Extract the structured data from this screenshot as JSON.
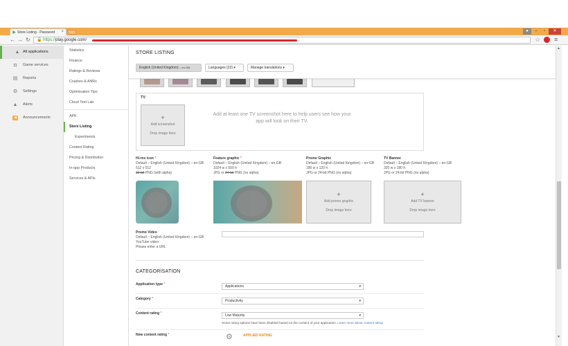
{
  "browser": {
    "tab_title": "Store Listing - Password",
    "tab_close": "×",
    "url_scheme": "https://",
    "url_domain": "play.google.com",
    "url_rest": "/",
    "window_controls": {
      "minimize": "–",
      "maximize": "▫",
      "close": "✕"
    }
  },
  "leftnav": {
    "items": [
      {
        "label": "All applications",
        "icon": "android-icon"
      },
      {
        "label": "Game services",
        "icon": "gamepad-icon"
      },
      {
        "label": "Reports",
        "icon": "report-icon"
      },
      {
        "label": "Settings",
        "icon": "gear-icon"
      },
      {
        "label": "Alerts",
        "icon": "warning-icon"
      },
      {
        "label": "Announcements",
        "icon": "announcement-icon"
      }
    ]
  },
  "subnav": {
    "items": [
      "Statistics",
      "Finance",
      "Ratings & Reviews",
      "Crashes & ANRs",
      "Optimisation Tips",
      "Cloud Test Lab",
      "APK",
      "Store Listing",
      "Experiments",
      "Content Rating",
      "Pricing & Distribution",
      "In-app Products",
      "Services & APIs"
    ]
  },
  "header": {
    "title": "STORE LISTING",
    "lang_button": "English (United Kingdom)",
    "lang_code": "– en-GB",
    "languages_button": "Languages (22)",
    "manage_button": "Manage translations",
    "caret": "▾"
  },
  "tv": {
    "label": "TV",
    "add_label": "Add screenshot",
    "drop_label": "Drop image here",
    "hint": "Add at least one TV screenshot here to help users see how your app will look on their TV."
  },
  "assets": {
    "hires": {
      "name": "Hi-res icon",
      "default": "Default – English (United Kingdom) – en-GB",
      "size": "512 x 512",
      "format_a": "32-bit",
      "format_b": " PNG (with alpha)"
    },
    "feature": {
      "name": "Feature graphic",
      "default": "Default – English (United Kingdom) – en-GB",
      "size": "1024 w x 500 h",
      "format_a": "JPG or ",
      "format_strike": "24-bit",
      "format_b": " PNG (no alpha)"
    },
    "promo": {
      "name": "Promo Graphic",
      "default": "Default – English (United Kingdom) – en-GB",
      "size": "180 w x 120 h",
      "format": "JPG or 24-bit PNG (no alpha)",
      "add_label": "Add promo graphic",
      "drop_label": "Drop image here"
    },
    "tvbanner": {
      "name": "TV Banner",
      "default": "Default – English (United Kingdom) – en-GB",
      "size": "320 w x 180 h",
      "format": "JPG or 24-bit PNG (no alpha)",
      "add_label": "Add TV banner",
      "drop_label": "Drop image here"
    },
    "required_mark": "*"
  },
  "promo_video": {
    "name": "Promo Video",
    "default": "Default – English (United Kingdom) – en-GB",
    "type": "YouTube video",
    "hint": "Please enter a URL",
    "value": ""
  },
  "categorisation": {
    "title": "CATEGORISATION",
    "application_type": {
      "label": "Application type",
      "value": "Applications"
    },
    "category": {
      "label": "Category",
      "value": "Productivity"
    },
    "content_rating": {
      "label": "Content rating",
      "value": "Low Maturity"
    },
    "note": "Some rating options have been disabled based on the content of your application.",
    "note_link": "Learn more about content rating",
    "new_content_rating": {
      "label": "New content rating",
      "badge": "APPLIED RATING"
    }
  },
  "colors": {
    "accent_green": "#6ab04c",
    "tabbar_orange": "#f2a94a",
    "applied_orange": "#e08e1c",
    "link_blue": "#3b7bbf"
  }
}
